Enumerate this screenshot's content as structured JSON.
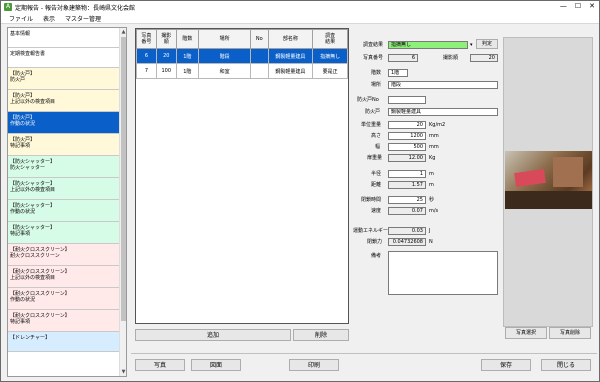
{
  "window": {
    "title": "定期報告 - 報告対象建築物：長崎県文化会館",
    "minimize": "—",
    "maximize": "☐",
    "close": "✕"
  },
  "menu": [
    "ファイル",
    "表示",
    "マスター管理"
  ],
  "sidebar": {
    "items": [
      {
        "lines": [
          "基本情報"
        ],
        "color": "#ffffff"
      },
      {
        "lines": [
          "定期検査報告書"
        ],
        "color": "#ffffff"
      },
      {
        "lines": [
          "【防火戸】",
          "防火戸"
        ],
        "color": "#fff9d9"
      },
      {
        "lines": [
          "【防火戸】",
          "上記以外の検査項目"
        ],
        "color": "#fff9d9"
      },
      {
        "lines": [
          "【防火戸】",
          "作動の状況"
        ],
        "color": "#0a60c8",
        "selected": true
      },
      {
        "lines": [
          "【防火戸】",
          "特記事項"
        ],
        "color": "#fff9d9"
      },
      {
        "lines": [
          "【防火シャッター】",
          "防火シャッター"
        ],
        "color": "#d6fbe6"
      },
      {
        "lines": [
          "【防火シャッター】",
          "上記以外の検査項目"
        ],
        "color": "#d6fbe6"
      },
      {
        "lines": [
          "【防火シャッター】",
          "作動の状況"
        ],
        "color": "#d6fbe6"
      },
      {
        "lines": [
          "【防火シャッター】",
          "特記事項"
        ],
        "color": "#d6fbe6"
      },
      {
        "lines": [
          "【耐火クロススクリーン】",
          "耐火クロススクリーン"
        ],
        "color": "#ffe9e9"
      },
      {
        "lines": [
          "【耐火クロススクリーン】",
          "上記以外の検査項目"
        ],
        "color": "#ffe9e9"
      },
      {
        "lines": [
          "【耐火クロススクリーン】",
          "作動の状況"
        ],
        "color": "#ffe9e9"
      },
      {
        "lines": [
          "【耐火クロススクリーン】",
          "特記事項"
        ],
        "color": "#ffe9e9"
      },
      {
        "lines": [
          "【ドレンチャー】"
        ],
        "color": "#d6ecff"
      }
    ]
  },
  "grid": {
    "columns": [
      "写真\n番号",
      "撮影\n順",
      "階数",
      "場所",
      "No",
      "部名称",
      "調査\n結果"
    ],
    "rows": [
      {
        "cells": [
          "6",
          "20",
          "1階",
          "階段",
          "",
          "鋼製軽量建具",
          "指摘無し"
        ],
        "selected": true
      },
      {
        "cells": [
          "7",
          "100",
          "1階",
          "和室",
          "",
          "鋼製軽量建具",
          "要是正"
        ],
        "selected": false
      }
    ],
    "add_label": "追加",
    "delete_label": "削除"
  },
  "form": {
    "survey_result_label": "調査結果",
    "survey_result_value": "指摘無し",
    "judge_button": "判定",
    "photo_no_label": "写真番号",
    "photo_no_value": "6",
    "shoot_order_label": "撮影順",
    "shoot_order_value": "20",
    "floor_label": "階数",
    "floor_value": "1階",
    "place_label": "場所",
    "place_value": "階段",
    "firedoor_no_label": "防火戸No",
    "firedoor_no_value": "",
    "firedoor_label": "防火戸",
    "firedoor_value": "鋼製軽量建具",
    "unit_weight_label": "単位重量",
    "unit_weight_value": "20",
    "unit_weight_unit": "Kg/m2",
    "height_label": "高さ",
    "height_value": "1200",
    "height_unit": "mm",
    "width_label": "幅",
    "width_value": "500",
    "width_unit": "mm",
    "door_weight_label": "扉重量",
    "door_weight_value": "12.00",
    "door_weight_unit": "Kg",
    "radius_label": "半径",
    "radius_value": "1",
    "radius_unit": "m",
    "distance_label": "距離",
    "distance_value": "1.57",
    "distance_unit": "m",
    "close_time_label": "閉鎖時間",
    "close_time_value": "25",
    "close_time_unit": "秒",
    "speed_label": "速度",
    "speed_value": "0.07",
    "speed_unit": "m/s",
    "kinetic_label": "運動エネルギー",
    "kinetic_value": "0.03",
    "kinetic_unit": "J",
    "close_force_label": "閉鎖力",
    "close_force_value": "0.04732608",
    "close_force_unit": "N",
    "remarks_label": "備考",
    "remarks_value": ""
  },
  "photo": {
    "select_label": "写真選択",
    "delete_label": "写真削除"
  },
  "bottom": {
    "photo_label": "写真",
    "drawing_label": "図面",
    "print_label": "印刷",
    "save_label": "保存",
    "close_label": "閉じる"
  }
}
